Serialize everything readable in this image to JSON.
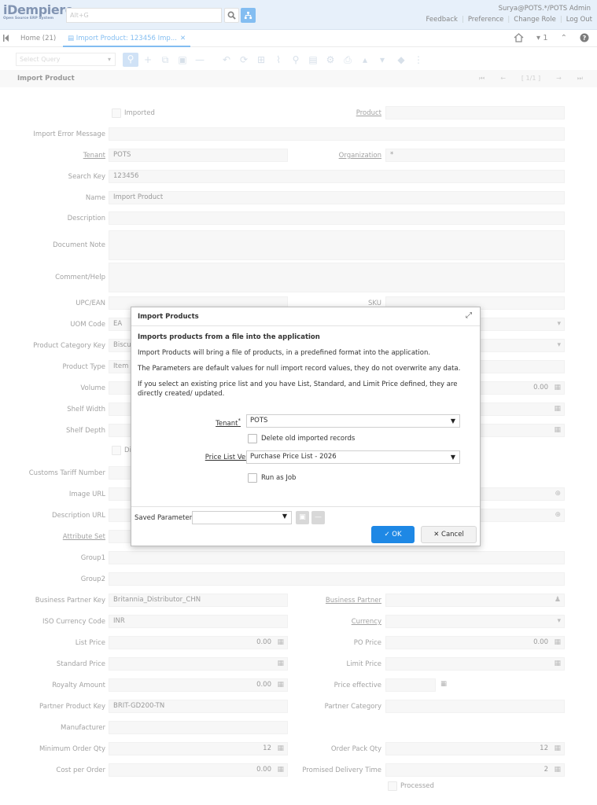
{
  "app": {
    "logo_text": "iDempiere",
    "logo_tagline": "Open Source ERP System",
    "search_placeholder": "Alt+G"
  },
  "user": {
    "name": "Surya@POTS.*/POTS Admin"
  },
  "top_links": [
    "Feedback",
    "Preference",
    "Change Role",
    "Log Out"
  ],
  "tabs": {
    "home": "Home (21)",
    "import": "Import Product: 123456 Imp...",
    "close": "✕",
    "window_count": "1"
  },
  "toolbar": {
    "select_query_placeholder": "Select Query"
  },
  "header": {
    "title": "Import Product",
    "record_nav": "[ 1/1 ]"
  },
  "form": {
    "imported_label": "Imported",
    "product_label": "Product",
    "import_error_label": "Import Error Message",
    "tenant_label": "Tenant",
    "tenant_value": "POTS",
    "organization_label": "Organization",
    "organization_value": "*",
    "search_key_label": "Search Key",
    "search_key_value": "123456",
    "name_label": "Name",
    "name_value": "Import Product",
    "description_label": "Description",
    "document_note_label": "Document Note",
    "comment_label": "Comment/Help",
    "upc_label": "UPC/EAN",
    "sku_label": "SKU",
    "uom_label": "UOM Code",
    "uom_value": "EA",
    "category_label": "Product Category Key",
    "category_value": "Biscuit",
    "type_label": "Product Type",
    "type_value": "Item",
    "volume_label": "Volume",
    "volume_right": "0.00",
    "shelf_width_label": "Shelf Width",
    "shelf_depth_label": "Shelf Depth",
    "di_label": "Di",
    "customs_label": "Customs Tariff Number",
    "image_url_label": "Image URL",
    "description_url_label": "Description URL",
    "attribute_set_label": "Attribute Set",
    "group1_label": "Group1",
    "group2_label": "Group2",
    "bp_key_label": "Business Partner Key",
    "bp_key_value": "Britannia_Distributor_CHN",
    "bp_label": "Business Partner",
    "iso_currency_label": "ISO Currency Code",
    "iso_currency_value": "INR",
    "currency_label": "Currency",
    "list_price_label": "List Price",
    "list_price_value": "0.00",
    "po_price_label": "PO Price",
    "po_price_value": "0.00",
    "standard_price_label": "Standard Price",
    "limit_price_label": "Limit Price",
    "royalty_label": "Royalty Amount",
    "royalty_value": "0.00",
    "price_effective_label": "Price effective",
    "partner_product_key_label": "Partner Product Key",
    "partner_product_key_value": "BRIT-GD200-TN",
    "partner_category_label": "Partner Category",
    "manufacturer_label": "Manufacturer",
    "min_order_label": "Minimum Order Qty",
    "min_order_value": "12",
    "order_pack_label": "Order Pack Qty",
    "order_pack_value": "12",
    "cost_per_order_label": "Cost per Order",
    "cost_per_order_value": "0.00",
    "promised_delivery_label": "Promised Delivery Time",
    "promised_delivery_value": "2",
    "processed_label": "Processed"
  },
  "dialog": {
    "title": "Import Products",
    "heading": "Imports products from a file into the application",
    "p1": "Import Products will bring a file of products, in a predefined format into the application.",
    "p2": "The Parameters are default values for null import record values, they do not overwrite any data.",
    "p3": "If you select an existing price list and you have List, Standard, and Limit Price defined, they are directly created/ updated.",
    "tenant_label": "Tenant",
    "tenant_value": "POTS",
    "delete_old_label": "Delete old imported records",
    "price_list_label": "Price List Version",
    "price_list_value": "Purchase Price List - 2026",
    "run_as_job_label": "Run as Job",
    "saved_params_label": "Saved Parameters",
    "ok_label": "OK",
    "cancel_label": "Cancel"
  }
}
